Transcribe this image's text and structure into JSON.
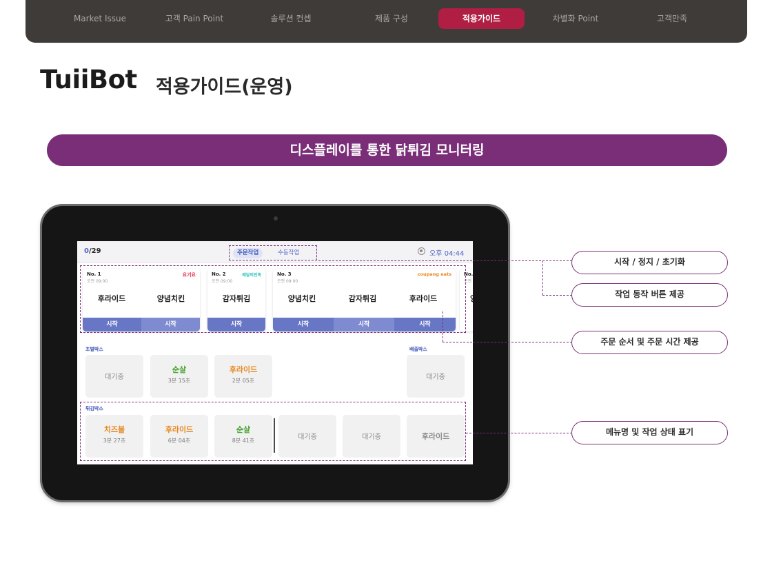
{
  "nav": {
    "items": [
      "Market Issue",
      "고객 Pain Point",
      "솔루션 컨셉",
      "제품 구성",
      "적용가이드",
      "차별화 Point",
      "고객만족"
    ],
    "active_index": 4
  },
  "header": {
    "brand": "TuiiBot",
    "title": "적용가이드(운영)"
  },
  "banner": {
    "text": "디스플레이를 통한 닭튀김 모니터링"
  },
  "screen": {
    "counter_current": "0",
    "counter_total": "/29",
    "tabs": {
      "order_work": "주문작업",
      "manual_work": "수동작업"
    },
    "time": "오후 04:44",
    "orders": [
      {
        "no": "No. 1",
        "time": "오전 09:00",
        "platform": "요기요",
        "platform_color": "#e0304d",
        "items": [
          "후라이드",
          "양념치킨"
        ],
        "button": "시작"
      },
      {
        "no": "No. 2",
        "time": "오전 09:00",
        "platform": "배달의민족",
        "platform_color": "#2ac1bc",
        "items": [
          "감자튀김"
        ],
        "button": "시작"
      },
      {
        "no": "No. 3",
        "time": "오전 09:00",
        "platform": "coupang eats",
        "platform_color": "#e8871c",
        "items": [
          "양념치킨",
          "감자튀김",
          "후라이드"
        ],
        "button": "시작"
      },
      {
        "no": "No. 4",
        "time": "오전 09",
        "items": [
          "양"
        ]
      }
    ],
    "initial_box": {
      "label": "초벌박스",
      "slots": [
        {
          "state": "대기중"
        },
        {
          "name": "순살",
          "time": "3분 15초",
          "color": "green"
        },
        {
          "name": "후라이드",
          "time": "2분 05초",
          "color": "orange"
        }
      ]
    },
    "out_box": {
      "label": "배출박스",
      "state": "대기중"
    },
    "fry_box": {
      "label": "튀김박스",
      "slots": [
        {
          "name": "치즈볼",
          "time": "3분 27초",
          "color": "orange"
        },
        {
          "name": "후라이드",
          "time": "6분 04초",
          "color": "orange"
        },
        {
          "name": "순살",
          "time": "8분 41초",
          "color": "green"
        },
        {
          "state": "대기중"
        },
        {
          "state": "대기중"
        },
        {
          "name": "후라이드",
          "color": "orange"
        }
      ]
    }
  },
  "callouts": [
    "시작 / 정지 / 초기화",
    "작업 동작 버튼 제공",
    "주문 순서 및 주문 시간 제공",
    "메뉴명 및 작업 상태 표기"
  ],
  "colors": {
    "accent": "#7a2e78",
    "nav_active": "#b01e44",
    "button_blue": "#6876c6"
  }
}
